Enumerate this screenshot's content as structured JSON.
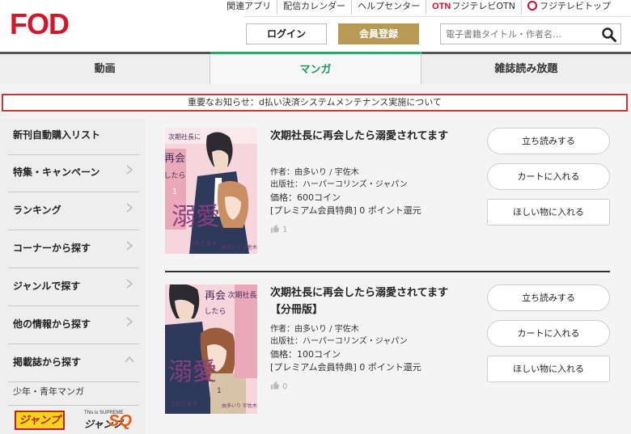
{
  "header": {
    "logo": "FOD",
    "top_links": [
      "関連アプリ",
      "配信カレンダー",
      "ヘルプセンター"
    ],
    "otn_mark": "OTN",
    "otn_label": "フジテレビOTN",
    "fujitv_label": "フジテレビトップ",
    "login_label": "ログイン",
    "register_label": "会員登録",
    "search_placeholder": "電子書籍タイトル・作者名…"
  },
  "nav": {
    "tabs": [
      "動画",
      "マンガ",
      "雑誌読み放題"
    ],
    "active": "マンガ"
  },
  "notice": "重要なお知らせ：d払い決済システムメンテナンス実施について",
  "sidebar": {
    "items": [
      {
        "label": "新刊自動購入リスト",
        "chevron": "none"
      },
      {
        "label": "特集・キャンペーン",
        "chevron": "right"
      },
      {
        "label": "ランキング",
        "chevron": "right"
      },
      {
        "label": "コーナーから探す",
        "chevron": "right"
      },
      {
        "label": "ジャンルで探す",
        "chevron": "right"
      },
      {
        "label": "他の情報から探す",
        "chevron": "right"
      },
      {
        "label": "掲載誌から探す",
        "chevron": "up"
      }
    ],
    "sub_label": "少年・青年マンガ",
    "jump_logo": "ジャンプ",
    "sq_small": "This is SUPREME",
    "sq_prefix": "ジャンプ",
    "sq_mark": "SQ"
  },
  "items": [
    {
      "title": "次期社長に再会したら溺愛されてます",
      "author": "作者：由多いり / 宇佐木",
      "publisher": "出版社：ハーパーコリンズ・ジャパン",
      "price": "価格：600コイン",
      "bonus": "[プレミアム会員特典] 0 ポイント還元",
      "likes": "1",
      "cover": {
        "title_lines": [
          "次期社長に",
          "再会",
          "したら",
          "溺愛"
        ],
        "volume": "1",
        "sub": "されてます",
        "authors": "由多いり 宇佐木"
      },
      "buttons": [
        "立ち読みする",
        "カートに入れる",
        "ほしい物に入れる"
      ]
    },
    {
      "title": "次期社長に再会したら溺愛されてます【分冊版】",
      "author": "作者：由多いり / 宇佐木",
      "publisher": "出版社：ハーパーコリンズ・ジャパン",
      "price": "価格：100コイン",
      "bonus": "[プレミアム会員特典] 0 ポイント還元",
      "likes": "0",
      "cover": {
        "title_lines": [
          "次期社長に",
          "再会",
          "したら",
          "溺愛"
        ],
        "volume": "1",
        "sub": "されてます",
        "authors": "由多いり 宇佐木"
      },
      "buttons": [
        "立ち読みする",
        "カートに入れる",
        "ほしい物に入れる"
      ]
    }
  ],
  "colors": {
    "brand_red": "#d7142a",
    "gold": "#b89a55",
    "manga_green": "#1a9a5a",
    "notice_border": "#c03a3a"
  }
}
